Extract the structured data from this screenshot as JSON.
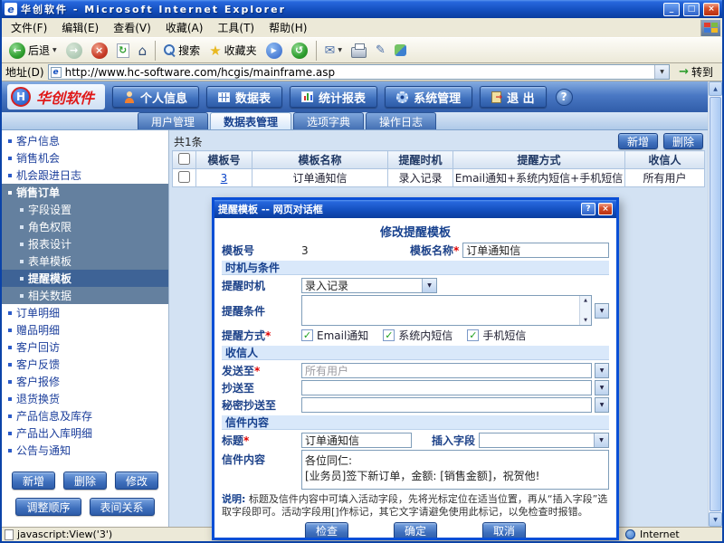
{
  "icons": {
    "ie-icon": "e",
    "minimize-icon": "_",
    "maximize-icon": "□",
    "close-icon": "×",
    "back-icon": "←",
    "forward-icon": "→",
    "stop-icon": "×",
    "refresh-icon": "↻",
    "home-icon": "⌂",
    "search-icon": "magnifier-shape",
    "favorites-icon": "★",
    "media-icon": "▶",
    "history-icon": "↺",
    "mail-icon": "✉",
    "print-icon": "printer-shape",
    "edit-icon": "✎",
    "messenger-icon": "two-tone-square-shape",
    "dropdown-icon": "▼",
    "up-icon": "▲",
    "go-icon": "→",
    "help-icon": "?",
    "check-icon": "✓",
    "brand-logo": "H",
    "windows-logo": "windows-flag-shape",
    "globe-icon": "globe-shape",
    "person-icon": "person-shape",
    "table-icon": "grid-shape",
    "chart-icon": "bars-shape",
    "gear-icon": "gear-shape",
    "exit-icon": "door-shape",
    "bullet-icon": "square-bullet",
    "page-icon": "page-shape"
  },
  "titlebar": {
    "title": "华创软件 - Microsoft Internet Explorer"
  },
  "menubar": {
    "items": [
      "文件(F)",
      "编辑(E)",
      "查看(V)",
      "收藏(A)",
      "工具(T)",
      "帮助(H)"
    ]
  },
  "toolbar": {
    "back_label": "后退",
    "search_label": "搜索",
    "favorites_label": "收藏夹"
  },
  "addressbar": {
    "label": "地址(D)",
    "url": "http://www.hc-software.com/hcgis/mainframe.asp",
    "go_label": "转到"
  },
  "header": {
    "brand": "华创软件",
    "nav": [
      {
        "label": "个人信息"
      },
      {
        "label": "数据表"
      },
      {
        "label": "统计报表"
      },
      {
        "label": "系统管理"
      },
      {
        "label": "退 出"
      }
    ]
  },
  "tabs": [
    {
      "label": "用户管理"
    },
    {
      "label": "数据表管理"
    },
    {
      "label": "选项字典"
    },
    {
      "label": "操作日志"
    }
  ],
  "sidebar": {
    "items_top": [
      "客户信息",
      "销售机会",
      "机会跟进日志"
    ],
    "group_label": "销售订单",
    "group_children": [
      "字段设置",
      "角色权限",
      "报表设计",
      "表单模板",
      "提醒模板",
      "相关数据"
    ],
    "selected_child": "提醒模板",
    "items_bottom": [
      "订单明细",
      "赠品明细",
      "客户回访",
      "客户反馈",
      "客户报修",
      "退货换货",
      "产品信息及库存",
      "产品出入库明细",
      "公告与通知"
    ],
    "buttons": [
      "新增",
      "删除",
      "修改",
      "调整顺序",
      "表间关系"
    ]
  },
  "content": {
    "count": "共1条",
    "add_label": "新增",
    "delete_label": "删除",
    "table": {
      "headers": [
        "模板号",
        "模板名称",
        "提醒时机",
        "提醒方式",
        "收信人"
      ],
      "row": {
        "id": "3",
        "name": "订单通知信",
        "timing": "录入记录",
        "method": "Email通知+系统内短信+手机短信",
        "recipients": "所有用户"
      }
    }
  },
  "dialog": {
    "title": "提醒模板 -- 网页对话框",
    "heading": "修改提醒模板",
    "template_no_label": "模板号",
    "template_no_value": "3",
    "template_name_label": "模板名称",
    "template_name_value": "订单通知信",
    "section_timing": "时机与条件",
    "timing_label": "提醒时机",
    "timing_value": "录入记录",
    "condition_label": "提醒条件",
    "method_label": "提醒方式",
    "method_options": [
      "Email通知",
      "系统内短信",
      "手机短信"
    ],
    "method_checked": [
      true,
      true,
      true
    ],
    "section_recipients": "收信人",
    "send_to_label": "发送至",
    "send_to_value": "所有用户",
    "cc_label": "抄送至",
    "bcc_label": "秘密抄送至",
    "section_content": "信件内容",
    "subject_label": "标题",
    "subject_value": "订单通知信",
    "insert_field_label": "插入字段",
    "body_label": "信件内容",
    "body_value": "各位同仁:\n[业务员]签下新订单，金额: [销售金额]，祝贺他!",
    "note_prefix": "说明:",
    "note_body": " 标题及信件内容中可填入活动字段，先将光标定位在适当位置，再从“插入字段”选取字段即可。活动字段用[]作标记，其它文字请避免使用此标记，以免检查时报错。",
    "check_label": "检查",
    "ok_label": "确定",
    "cancel_label": "取消"
  },
  "statusbar": {
    "left": "javascript:View('3')",
    "zone": "Internet"
  }
}
